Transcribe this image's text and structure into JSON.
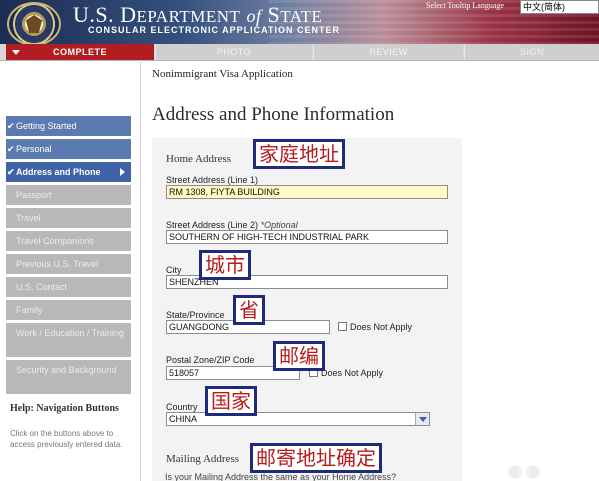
{
  "header": {
    "dept_prefix": "U.S. D",
    "dept_rest": "EPARTMENT",
    "of": "of",
    "state_s": "S",
    "state_rest": "TATE",
    "subtitle": "CONSULAR ELECTRONIC APPLICATION CENTER",
    "tooltip_language_label": "Select Tooltip Language",
    "tooltip_language_value": "中文(简体)"
  },
  "progress_tabs": [
    {
      "label": "COMPLETE",
      "state": "active"
    },
    {
      "label": "PHOTO",
      "state": "inactive"
    },
    {
      "label": "REVIEW",
      "state": "inactive"
    },
    {
      "label": "SIGN",
      "state": "inactive"
    }
  ],
  "breadcrumb": "Nonimmigrant Visa Application",
  "sidebar": {
    "items": [
      {
        "label": "Getting Started",
        "state": "done"
      },
      {
        "label": "Personal",
        "state": "done"
      },
      {
        "label": "Address and Phone",
        "state": "current"
      },
      {
        "label": "Passport",
        "state": "todo"
      },
      {
        "label": "Travel",
        "state": "todo"
      },
      {
        "label": "Travel Companions",
        "state": "todo"
      },
      {
        "label": "Previous U.S. Travel",
        "state": "todo"
      },
      {
        "label": "U.S. Contact",
        "state": "todo"
      },
      {
        "label": "Family",
        "state": "todo"
      },
      {
        "label": "Work / Education / Training",
        "state": "todo"
      },
      {
        "label": "Security and Background",
        "state": "todo"
      }
    ],
    "help_title": "Help: Navigation Buttons",
    "help_text": "Click on the buttons above to access previously entered data."
  },
  "page_title": "Address and Phone Information",
  "form": {
    "home_address_label": "Home Address",
    "street1_label": "Street Address (Line 1)",
    "street1_value": "RM 1308, FIYTA BUILDING",
    "street2_label": "Street Address (Line 2)",
    "street2_optional": "*Optional",
    "street2_value": "SOUTHERN OF HIGH-TECH INDUSTRIAL PARK",
    "city_label": "City",
    "city_value": "SHENZHEN",
    "state_label": "State/Province",
    "state_value": "GUANGDONG",
    "state_dna": "Does Not Apply",
    "postal_label": "Postal Zone/ZIP Code",
    "postal_value": "518057",
    "postal_dna": "Does Not Apply",
    "country_label": "Country",
    "country_value": "CHINA",
    "mailing_address_label": "Mailing Address",
    "mailing_question": "Is your Mailing Address the same as your Home Address?"
  },
  "annotations": {
    "home_address": "家庭地址",
    "city": "城市",
    "province": "省",
    "postal": "邮编",
    "country": "国家",
    "mailing": "邮寄地址确定"
  },
  "colors": {
    "complete_tab": "#b11d23",
    "nav_done": "#5b7bb0",
    "nav_current": "#3f63a6",
    "nav_todo": "#b8b8b8",
    "annotation_border": "#1f2a7a",
    "annotation_text": "#b71c1c"
  }
}
